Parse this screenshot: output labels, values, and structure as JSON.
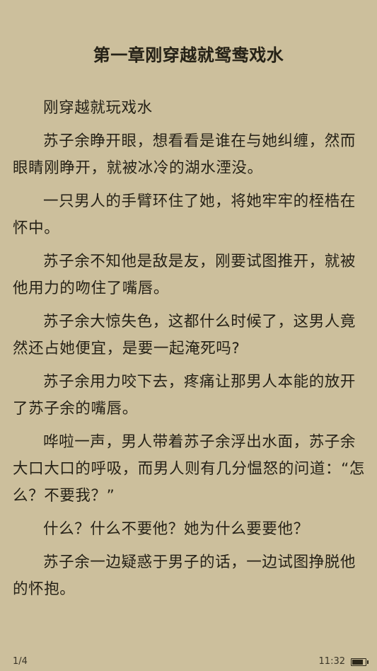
{
  "chapter": {
    "title": "第一章刚穿越就鸳鸯戏水"
  },
  "paragraphs": [
    "刚穿越就玩戏水",
    "苏子余睁开眼，想看看是谁在与她纠缠，然而眼睛刚睁开，就被冰冷的湖水湮没。",
    "一只男人的手臂环住了她，将她牢牢的桎梏在怀中。",
    "苏子余不知他是敌是友，刚要试图推开，就被他用力的吻住了嘴唇。",
    "苏子余大惊失色，这都什么时候了，这男人竟然还占她便宜，是要一起淹死吗?",
    "苏子余用力咬下去，疼痛让那男人本能的放开了苏子余的嘴唇。",
    "哗啦一声，男人带着苏子余浮出水面，苏子余大口大口的呼吸，而男人则有几分愠怒的问道：“怎么？不要我？”",
    "什么？什么不要他？她为什么要要他？",
    "苏子余一边疑惑于男子的话，一边试图挣脱他的怀抱。"
  ],
  "footer": {
    "page_indicator": "1/4",
    "time": "11:32",
    "battery_level": 0.85,
    "battery_icon": "battery-icon"
  },
  "colors": {
    "background": "#ccbf9c",
    "text": "#262217"
  }
}
